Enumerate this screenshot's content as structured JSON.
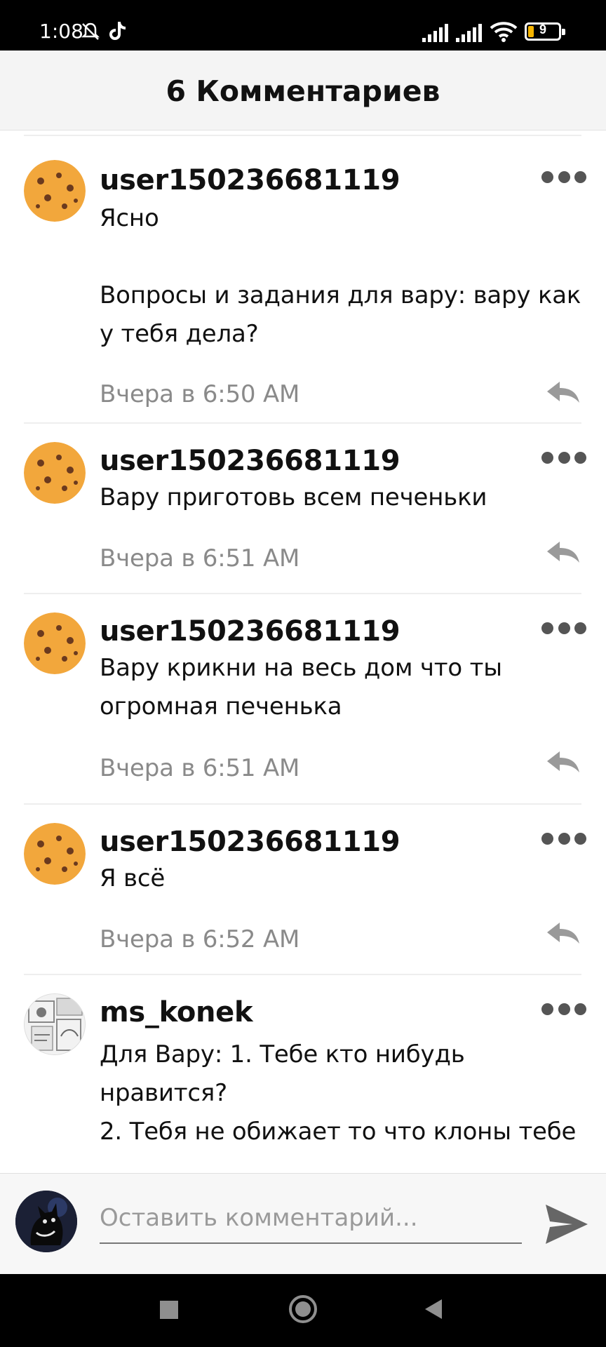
{
  "status_bar": {
    "time": "1:08",
    "battery_level": "9",
    "icons": [
      "notifications-off-icon",
      "tiktok-icon",
      "signal-icon",
      "signal-icon",
      "wifi-icon",
      "battery-icon"
    ]
  },
  "header": {
    "title": "6 Комментариев"
  },
  "comments": [
    {
      "username": "user150236681119",
      "avatar": "cookie-avatar",
      "text": "Ясно\n\nВопросы и задания для вару: вару как у тебя дела?",
      "time": "Вчера в 6:50 AM"
    },
    {
      "username": "user150236681119",
      "avatar": "cookie-avatar",
      "text": "Вару приготовь всем печеньки",
      "time": "Вчера в 6:51 AM"
    },
    {
      "username": "user150236681119",
      "avatar": "cookie-avatar",
      "text": "Вару крикни на весь дом что ты огромная печенька",
      "time": "Вчера в 6:51 AM"
    },
    {
      "username": "user150236681119",
      "avatar": "cookie-avatar",
      "text": "Я всё",
      "time": "Вчера в 6:52 AM"
    },
    {
      "username": "ms_konek",
      "avatar": "manga-avatar",
      "text": "Для Вару: 1. Тебе кто нибудь нравится?\n2. Тебя не обижает то что клоны тебе",
      "time": ""
    }
  ],
  "input": {
    "placeholder": "Оставить комментарий..."
  },
  "nav": {
    "buttons": [
      "recent-apps",
      "home",
      "back"
    ]
  },
  "colors": {
    "header_bg": "#f4f4f4",
    "time_text": "#8a8a8a",
    "cookie": "#f2a73c"
  }
}
